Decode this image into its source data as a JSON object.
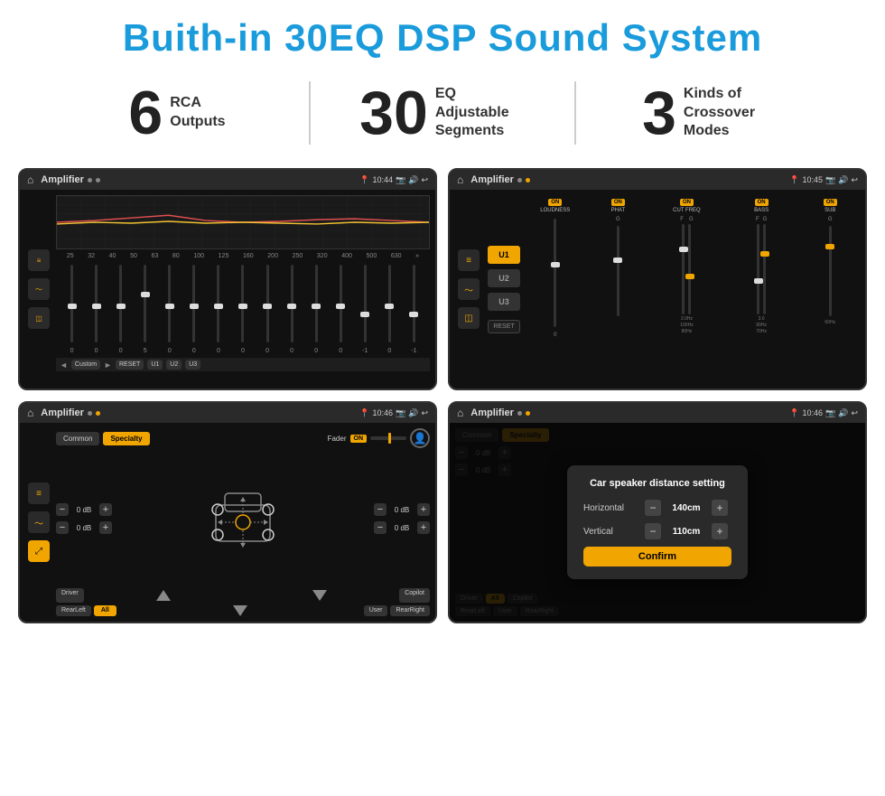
{
  "header": {
    "title": "Buith-in 30EQ DSP Sound System"
  },
  "stats": [
    {
      "number": "6",
      "text": "RCA\nOutputs"
    },
    {
      "number": "30",
      "text": "EQ Adjustable\nSegments"
    },
    {
      "number": "3",
      "text": "Kinds of\nCrossover Modes"
    }
  ],
  "screens": {
    "screen1": {
      "app": "Amplifier",
      "time": "10:44",
      "frequencies": [
        "25",
        "32",
        "40",
        "50",
        "63",
        "80",
        "100",
        "125",
        "160",
        "200",
        "250",
        "320",
        "400",
        "500",
        "630"
      ],
      "values": [
        "0",
        "0",
        "0",
        "5",
        "0",
        "0",
        "0",
        "0",
        "0",
        "0",
        "0",
        "0",
        "-1",
        "0",
        "-1"
      ],
      "sliderPositions": [
        50,
        50,
        50,
        35,
        50,
        50,
        50,
        50,
        50,
        50,
        50,
        50,
        60,
        50,
        60
      ],
      "preset": "Custom",
      "buttons": [
        "RESET",
        "U1",
        "U2",
        "U3"
      ]
    },
    "screen2": {
      "app": "Amplifier",
      "time": "10:45",
      "presets": [
        "U1",
        "U2",
        "U3"
      ],
      "channels": [
        "LOUDNESS",
        "PHAT",
        "CUT FREQ",
        "BASS",
        "SUB"
      ],
      "resetLabel": "RESET"
    },
    "screen3": {
      "app": "Amplifier",
      "time": "10:46",
      "tabs": [
        "Common",
        "Specialty"
      ],
      "faderLabel": "Fader",
      "onLabel": "ON",
      "dbValues": [
        "0 dB",
        "0 dB",
        "0 dB",
        "0 dB"
      ],
      "bottomBtns": [
        "Driver",
        "RearLeft",
        "All",
        "User",
        "RearRight",
        "Copilot"
      ]
    },
    "screen4": {
      "app": "Amplifier",
      "time": "10:46",
      "tabs": [
        "Common",
        "Specialty"
      ],
      "dialog": {
        "title": "Car speaker distance setting",
        "horizontal": {
          "label": "Horizontal",
          "value": "140cm"
        },
        "vertical": {
          "label": "Vertical",
          "value": "110cm"
        },
        "confirmLabel": "Confirm"
      },
      "dbValues": [
        "0 dB",
        "0 dB"
      ],
      "bottomBtns": [
        "Driver",
        "RearLeft",
        "All",
        "User",
        "RearRight",
        "Copilot"
      ]
    }
  }
}
